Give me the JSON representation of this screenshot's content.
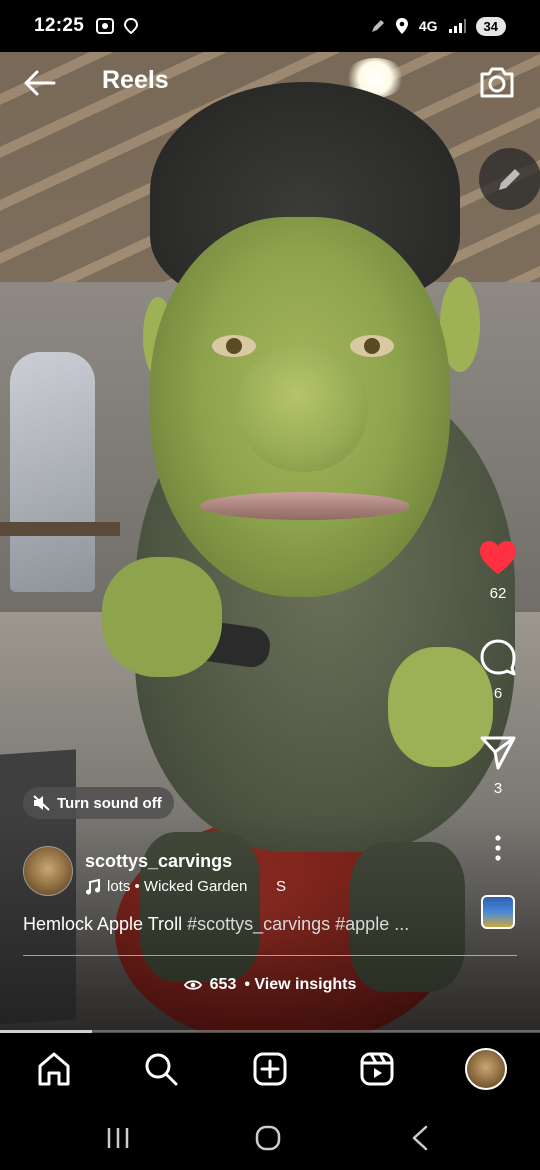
{
  "status_bar": {
    "time": "12:25",
    "network": "4G",
    "battery": "34",
    "icons": [
      "screenshot-icon",
      "location-pin-icon",
      "pen-icon",
      "location-icon",
      "signal-icon"
    ]
  },
  "header": {
    "title": "Reels",
    "icons": [
      "back-arrow-icon",
      "camera-icon",
      "edit-icon"
    ]
  },
  "actions": {
    "likes": "62",
    "comments": "6",
    "shares": "3",
    "like_color": "#ff3040"
  },
  "sound": {
    "label": "Turn sound off"
  },
  "post": {
    "username": "scottys_carvings",
    "audio": "lots • Wicked Garden",
    "audio_extra": "S",
    "caption_title": "Hemlock Apple Troll",
    "caption_tags": "#scottys_carvings #apple ...",
    "views": "653",
    "insights_label": "• View insights"
  },
  "progress": {
    "fraction": 0.17
  },
  "bottom_nav": {
    "items": [
      "home-icon",
      "search-icon",
      "create-icon",
      "reels-icon",
      "profile-avatar"
    ]
  },
  "system_nav": {
    "items": [
      "recent-apps-icon",
      "home-button-icon",
      "back-icon"
    ]
  }
}
